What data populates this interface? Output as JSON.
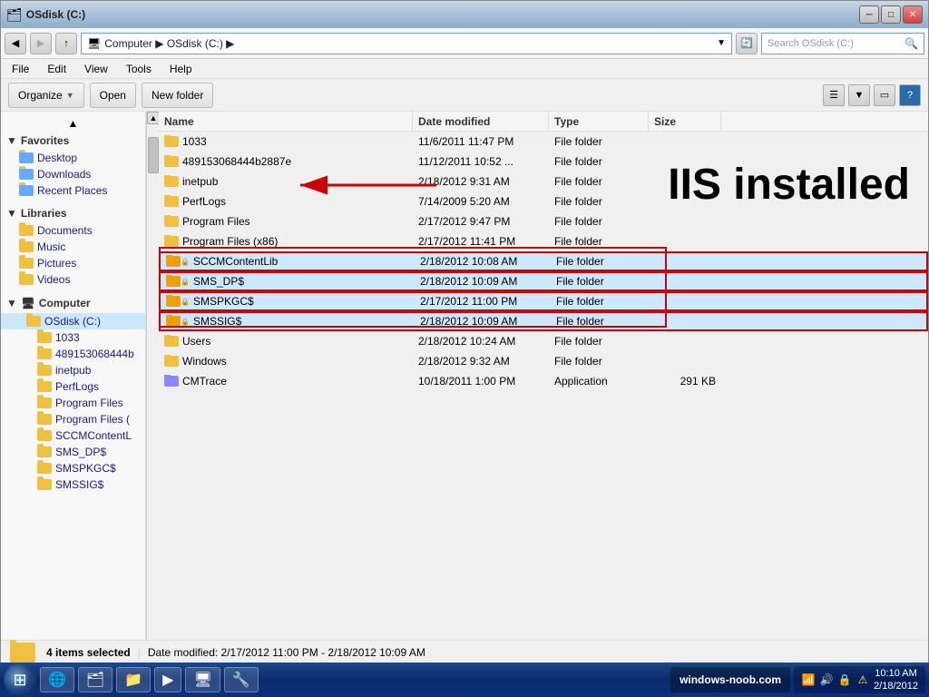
{
  "window": {
    "title": "OSdisk (C:)",
    "address": "Computer ▶ OSdisk (C:) ▶",
    "search_placeholder": "Search OSdisk (C:)"
  },
  "menu": {
    "items": [
      "File",
      "Edit",
      "View",
      "Tools",
      "Help"
    ]
  },
  "toolbar": {
    "organize_label": "Organize",
    "open_label": "Open",
    "new_folder_label": "New folder"
  },
  "sidebar": {
    "favorites": {
      "label": "Favorites",
      "items": [
        "Desktop",
        "Downloads",
        "Recent Places"
      ]
    },
    "libraries": {
      "label": "Libraries",
      "items": [
        "Documents",
        "Music",
        "Pictures",
        "Videos"
      ]
    },
    "computer": {
      "label": "Computer",
      "items": [
        "OSdisk (C:)"
      ]
    },
    "osdisk_children": [
      "1033",
      "489153068444b",
      "inetpub",
      "PerfLogs",
      "Program Files",
      "Program Files (",
      "SCCMContentL",
      "SMS_DP$",
      "SMSPKGC$",
      "SMSSIG$"
    ]
  },
  "columns": {
    "name": "Name",
    "date": "Date modified",
    "type": "Type",
    "size": "Size"
  },
  "files": [
    {
      "name": "1033",
      "date": "11/6/2011 11:47 PM",
      "type": "File folder",
      "size": "",
      "icon": "folder",
      "selected": false
    },
    {
      "name": "489153068444b2887e",
      "date": "11/12/2011 10:52 ...",
      "type": "File folder",
      "size": "",
      "icon": "folder",
      "selected": false
    },
    {
      "name": "inetpub",
      "date": "2/18/2012 9:31 AM",
      "type": "File folder",
      "size": "",
      "icon": "folder",
      "selected": false
    },
    {
      "name": "PerfLogs",
      "date": "7/14/2009 5:20 AM",
      "type": "File folder",
      "size": "",
      "icon": "folder",
      "selected": false
    },
    {
      "name": "Program Files",
      "date": "2/17/2012 9:47 PM",
      "type": "File folder",
      "size": "",
      "icon": "folder",
      "selected": false
    },
    {
      "name": "Program Files (x86)",
      "date": "2/17/2012 11:41 PM",
      "type": "File folder",
      "size": "",
      "icon": "folder",
      "selected": false
    },
    {
      "name": "SCCMContentLib",
      "date": "2/18/2012 10:08 AM",
      "type": "File folder",
      "size": "",
      "icon": "folder-lock",
      "selected": true
    },
    {
      "name": "SMS_DP$",
      "date": "2/18/2012 10:09 AM",
      "type": "File folder",
      "size": "",
      "icon": "folder-lock",
      "selected": true
    },
    {
      "name": "SMSPKGC$",
      "date": "2/17/2012 11:00 PM",
      "type": "File folder",
      "size": "",
      "icon": "folder-lock",
      "selected": true
    },
    {
      "name": "SMSSIG$",
      "date": "2/18/2012 10:09 AM",
      "type": "File folder",
      "size": "",
      "icon": "folder-lock",
      "selected": true
    },
    {
      "name": "Users",
      "date": "2/18/2012 10:24 AM",
      "type": "File folder",
      "size": "",
      "icon": "folder",
      "selected": false
    },
    {
      "name": "Windows",
      "date": "2/18/2012 9:32 AM",
      "type": "File folder",
      "size": "",
      "icon": "folder",
      "selected": false
    },
    {
      "name": "CMTrace",
      "date": "10/18/2011 1:00 PM",
      "type": "Application",
      "size": "291 KB",
      "icon": "app",
      "selected": false
    }
  ],
  "status": {
    "selected_count": "4 items selected",
    "date_range": "Date modified: 2/17/2012 11:00 PM - 2/18/2012 10:09 AM"
  },
  "annotation": {
    "iis_label": "IIS installed"
  },
  "taskbar": {
    "start": "⊞",
    "items": [
      "e",
      "🗂",
      "📁",
      "▶",
      "🖥",
      "🔧"
    ],
    "website": "windows-noob.com",
    "time": "10:10 AM",
    "date": "2/18/2012"
  }
}
